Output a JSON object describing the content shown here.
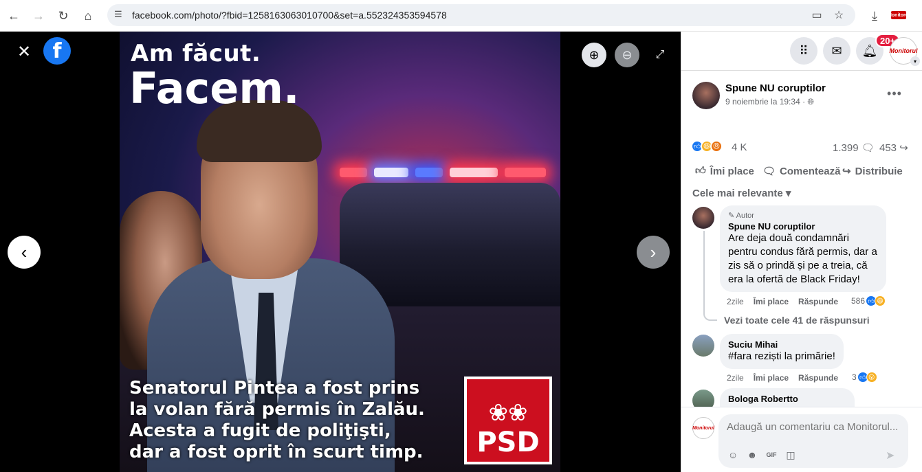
{
  "browser": {
    "url": "facebook.com/photo/?fbid=1258163063010700&set=a.552324353594578",
    "extension_label": "Monitorul"
  },
  "photo": {
    "headline_1": "Am făcut.",
    "headline_2": "Facem.",
    "caption_lines": [
      "Senatorul Pintea a fost prins",
      "la volan fără permis în Zalău.",
      "Acesta a fugit de poliţişti,",
      "dar a fost oprit în scurt timp."
    ],
    "logo_text": "PSD",
    "logo_color": "#cc0f1f"
  },
  "header": {
    "notif_badge": "20+",
    "profile_label": "Monitorul"
  },
  "post": {
    "page_name": "Spune NU coruptilor",
    "time": "9 noiembrie la 19:34 · ",
    "reactions_count": "4 K",
    "comments_count": "1.399",
    "shares_count": "453",
    "actions": {
      "like": "Îmi place",
      "comment": "Comentează",
      "share": "Distribuie"
    },
    "sort_label": "Cele mai relevante"
  },
  "comments": [
    {
      "badge": "Autor",
      "author": "Spune NU coruptilor",
      "text": "Are deja două condamnări pentru condus fără permis, dar a zis să o prindă și pe a treia, că era la ofertă de Black Friday!",
      "age": "2zile",
      "like": "Îmi place",
      "reply": "Răspunde",
      "reacts": "586"
    },
    {
      "author": "Suciu Mihai",
      "hashtag": "#fara",
      "text": " reziști la primărie!",
      "age": "2zile",
      "like": "Îmi place",
      "reply": "Răspunde",
      "reacts": "3"
    },
    {
      "author": "Bologa Robertto"
    }
  ],
  "replies_link": "Vezi toate cele 41 de răspunsuri",
  "composer": {
    "placeholder": "Adaugă un comentariu ca Monitorul...",
    "avatar_label": "Monitorul"
  },
  "colors": {
    "fb_blue": "#1877f2",
    "notif_red": "#e41e3f",
    "secondary_text": "#65676b"
  }
}
